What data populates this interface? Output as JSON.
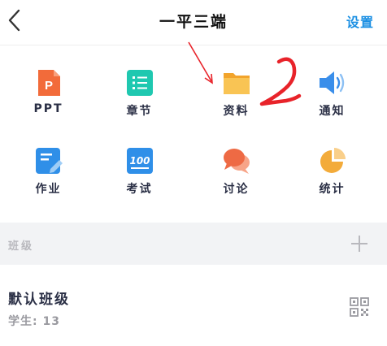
{
  "header": {
    "title": "一平三端",
    "settings_label": "设置",
    "back_icon": "chevron-left-icon"
  },
  "grid": [
    {
      "label": "PPT",
      "icon": "ppt-icon",
      "color": "#f26b3a"
    },
    {
      "label": "章节",
      "icon": "chapter-list-icon",
      "color": "#1fc8b0"
    },
    {
      "label": "资料",
      "icon": "folder-icon",
      "color": "#f8b43e"
    },
    {
      "label": "通知",
      "icon": "speaker-icon",
      "color": "#3a8eea"
    },
    {
      "label": "作业",
      "icon": "homework-edit-icon",
      "color": "#2f8fe8"
    },
    {
      "label": "考试",
      "icon": "exam-100-icon",
      "color": "#2f8fe8"
    },
    {
      "label": "讨论",
      "icon": "discussion-bubbles-icon",
      "color": "#ee6a44"
    },
    {
      "label": "统计",
      "icon": "pie-chart-icon",
      "color": "#f3ab3a"
    }
  ],
  "class_section": {
    "label": "班级",
    "add_icon": "plus-icon",
    "class_name": "默认班级",
    "students": "学生: 13",
    "qr_icon": "qr-code-icon"
  },
  "colors": {
    "accent": "#1a8fe3",
    "annotation": "#e8232a",
    "section_bg": "#f2f3f5"
  }
}
